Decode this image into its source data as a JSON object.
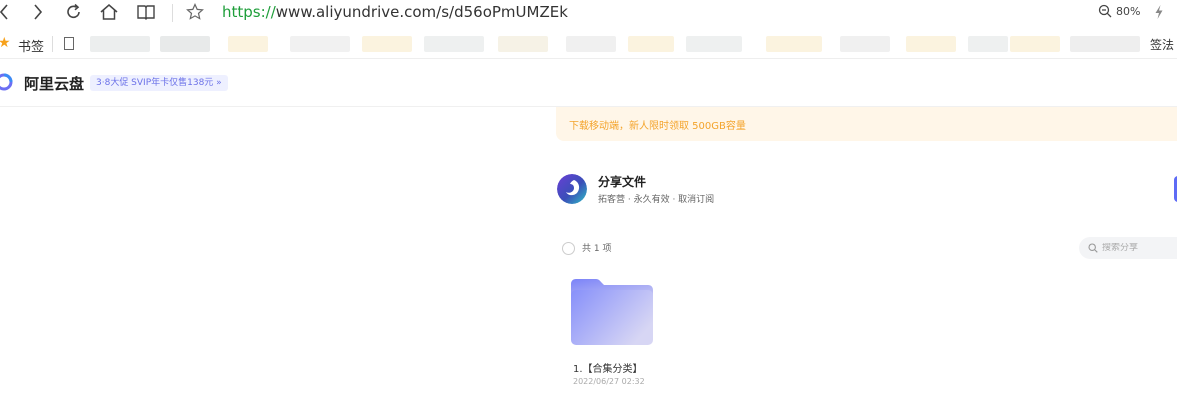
{
  "browser": {
    "url_protocol": "https://",
    "url_rest": "www.aliyundrive.com/s/d56oPmUMZEk",
    "zoom": "80%",
    "icons": [
      "back-icon",
      "forward-icon",
      "refresh-icon",
      "home-icon",
      "reader-icon",
      "star-icon",
      "zoom-icon",
      "lightning-icon"
    ]
  },
  "bookmarks": {
    "label": "书签",
    "right_label": "签法"
  },
  "app": {
    "brand": "阿里云盘",
    "promo": "3·8大促 SVIP年卡仅售138元 »"
  },
  "banner": {
    "text": "下载移动端，新人限时领取 500GB容量"
  },
  "share": {
    "title": "分享文件",
    "meta": "拓客营 · 永久有效 · 取消订阅",
    "count": "共 1 项",
    "search_placeholder": "搜索分享"
  },
  "files": [
    {
      "name": "1.【合集分类】",
      "date": "2022/06/27 02:32",
      "type": "folder"
    }
  ],
  "colors": {
    "url_green": "#1e9e3a",
    "accent": "#5e6bf5",
    "banner_bg": "#fff6e8",
    "banner_text": "#f4a42c",
    "promo_bg": "#eef0ff"
  }
}
